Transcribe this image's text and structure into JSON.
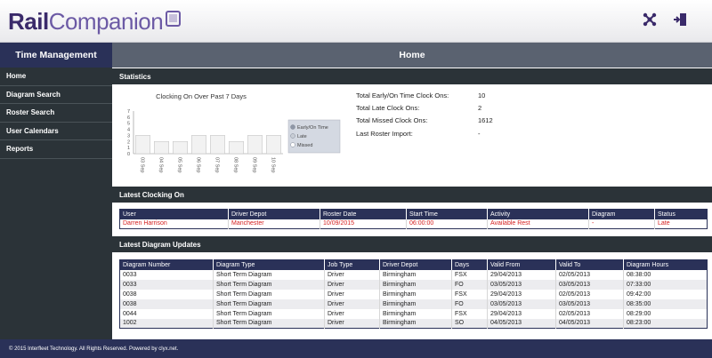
{
  "app": {
    "logo_rail": "Rail",
    "logo_companion": "Companion"
  },
  "header_icons": [
    {
      "name": "network-icon"
    },
    {
      "name": "logout-icon"
    }
  ],
  "sidebar": {
    "title": "Time Management",
    "items": [
      {
        "label": "Home"
      },
      {
        "label": "Diagram Search"
      },
      {
        "label": "Roster Search"
      },
      {
        "label": "User Calendars"
      },
      {
        "label": "Reports"
      }
    ]
  },
  "main": {
    "title": "Home"
  },
  "statistics": {
    "title": "Statistics",
    "rows": [
      {
        "label": "Total Early/On Time Clock Ons:",
        "value": "10"
      },
      {
        "label": "Total Late Clock Ons:",
        "value": "2"
      },
      {
        "label": "Total Missed Clock Ons:",
        "value": "1612"
      },
      {
        "label": "Last Roster Import:",
        "value": "-"
      }
    ]
  },
  "chart_data": {
    "type": "bar",
    "title": "Clocking On Over Past 7 Days",
    "categories": [
      "03 Sep",
      "04 Sep",
      "05 Sep",
      "06 Sep",
      "07 Sep",
      "08 Sep",
      "09 Sep",
      "10 Sep"
    ],
    "series": [
      {
        "name": "Early/On Time",
        "values": [
          3,
          2,
          2,
          3,
          3,
          2,
          3,
          3
        ]
      },
      {
        "name": "Late",
        "values": [
          0,
          0,
          0,
          0,
          0,
          0,
          0,
          0
        ]
      },
      {
        "name": "Missed",
        "values": [
          0,
          0,
          0,
          0,
          0,
          0,
          0,
          0
        ]
      }
    ],
    "ylim": [
      0,
      7
    ],
    "yticks": [
      0,
      1,
      2,
      3,
      4,
      5,
      6,
      7
    ],
    "legend_position": "right",
    "grid": false,
    "colors": {
      "bar": "#f2f2f2",
      "legend_bg": "#d4d9e2"
    }
  },
  "latest_clocking": {
    "title": "Latest Clocking On",
    "columns": [
      "User",
      "Driver Depot",
      "Roster Date",
      "Start Time",
      "Activity",
      "Diagram",
      "Status"
    ],
    "rows": [
      [
        "Darren Harrison",
        "Manchester",
        "10/09/2015",
        "06:00:00",
        "Available Rest",
        "-",
        "Late"
      ]
    ]
  },
  "latest_diagrams": {
    "title": "Latest Diagram Updates",
    "columns": [
      "Diagram Number",
      "Diagram Type",
      "Job Type",
      "Driver Depot",
      "Days",
      "Valid From",
      "Valid To",
      "Diagram Hours"
    ],
    "rows": [
      [
        "0033",
        "Short Term Diagram",
        "Driver",
        "Birmingham",
        "FSX",
        "29/04/2013",
        "02/05/2013",
        "08:38:00"
      ],
      [
        "0033",
        "Short Term Diagram",
        "Driver",
        "Birmingham",
        "FO",
        "03/05/2013",
        "03/05/2013",
        "07:33:00"
      ],
      [
        "0038",
        "Short Term Diagram",
        "Driver",
        "Birmingham",
        "FSX",
        "29/04/2013",
        "02/05/2013",
        "09:42:00"
      ],
      [
        "0038",
        "Short Term Diagram",
        "Driver",
        "Birmingham",
        "FO",
        "03/05/2013",
        "03/05/2013",
        "08:35:00"
      ],
      [
        "0044",
        "Short Term Diagram",
        "Driver",
        "Birmingham",
        "FSX",
        "29/04/2013",
        "02/05/2013",
        "08:29:00"
      ],
      [
        "1002",
        "Short Term Diagram",
        "Driver",
        "Birmingham",
        "SO",
        "04/05/2013",
        "04/05/2013",
        "08:23:00"
      ]
    ]
  },
  "footer": {
    "text": "© 2015 Interfleet Technology. All Rights Reserved. Powered by clyx.net."
  },
  "colors": {
    "navy": "#2a3158",
    "dark": "#2b3338",
    "grey_header": "#5a6270",
    "late_red": "#d42020"
  }
}
